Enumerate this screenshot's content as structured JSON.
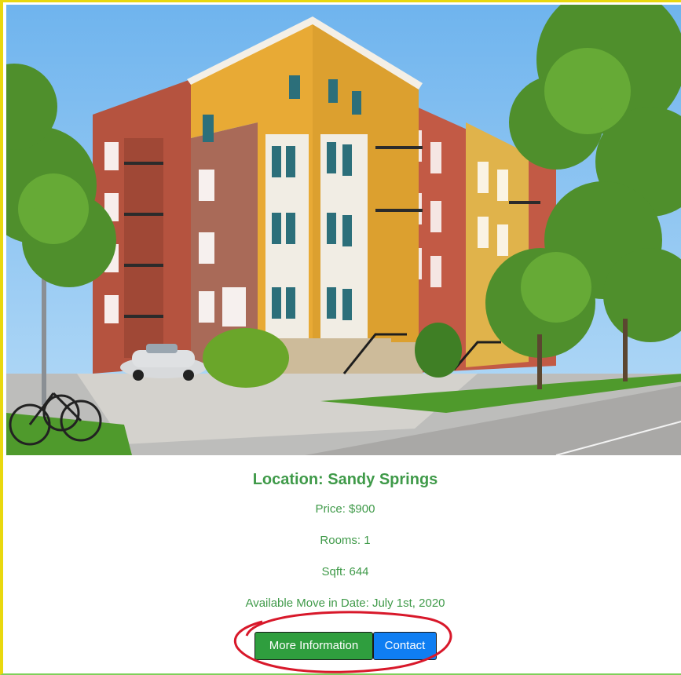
{
  "listing": {
    "image_alt": "Apartment building photo",
    "title": "Location: Sandy Springs",
    "price": "Price: $900",
    "rooms": "Rooms: 1",
    "sqft": "Sqft: 644",
    "move_in": "Available Move in Date: July 1st, 2020"
  },
  "actions": {
    "more_label": "More Information",
    "contact_label": "Contact"
  },
  "colors": {
    "text_green": "#3f9a49",
    "more_button": "#2f9e3e",
    "contact_button": "#0f7ef2",
    "card_border": "#e9d80f",
    "annotation": "#d8182a"
  }
}
